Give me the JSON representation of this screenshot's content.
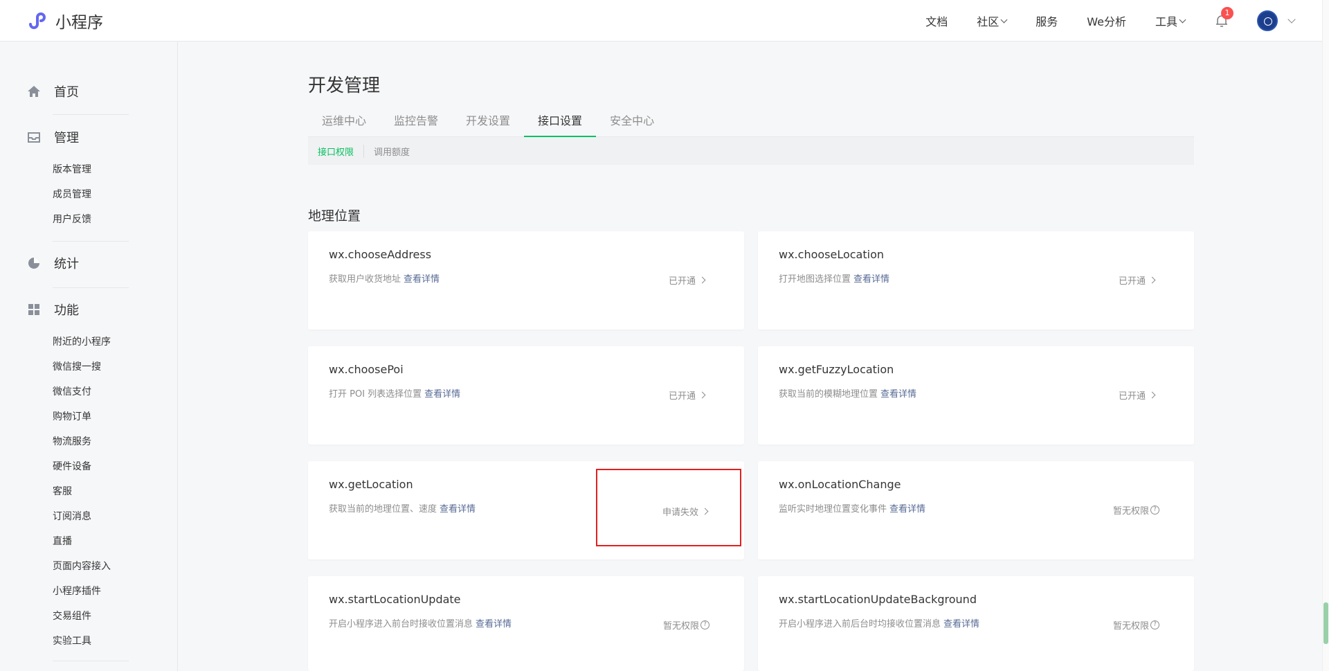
{
  "app": {
    "title": "小程序"
  },
  "nav": {
    "docs": "文档",
    "community": "社区",
    "service": "服务",
    "we_analysis": "We分析",
    "tools": "工具",
    "notification_count": "1"
  },
  "sidebar": {
    "home": "首页",
    "manage": "管理",
    "manage_items": [
      "版本管理",
      "成员管理",
      "用户反馈"
    ],
    "stats": "统计",
    "features": "功能",
    "feature_items": [
      "附近的小程序",
      "微信搜一搜",
      "微信支付",
      "购物订单",
      "物流服务",
      "硬件设备",
      "客服",
      "订阅消息",
      "直播",
      "页面内容接入",
      "小程序插件",
      "交易组件",
      "实验工具"
    ]
  },
  "page": {
    "title": "开发管理",
    "tabs": [
      "运维中心",
      "监控告警",
      "开发设置",
      "接口设置",
      "安全中心"
    ],
    "subtabs": [
      "接口权限",
      "调用额度"
    ],
    "section": "地理位置"
  },
  "cards": [
    {
      "name": "wx.chooseAddress",
      "desc": "获取用户收货地址",
      "link": "查看详情",
      "status": "已开通"
    },
    {
      "name": "wx.chooseLocation",
      "desc": "打开地图选择位置",
      "link": "查看详情",
      "status": "已开通"
    },
    {
      "name": "wx.choosePoi",
      "desc": "打开 POI 列表选择位置",
      "link": "查看详情",
      "status": "已开通"
    },
    {
      "name": "wx.getFuzzyLocation",
      "desc": "获取当前的模糊地理位置",
      "link": "查看详情",
      "status": "已开通"
    },
    {
      "name": "wx.getLocation",
      "desc": "获取当前的地理位置、速度",
      "link": "查看详情",
      "status": "申请失效"
    },
    {
      "name": "wx.onLocationChange",
      "desc": "监听实时地理位置变化事件",
      "link": "查看详情",
      "status": "暂无权限"
    },
    {
      "name": "wx.startLocationUpdate",
      "desc": "开启小程序进入前台时接收位置消息",
      "link": "查看详情",
      "status": "暂无权限"
    },
    {
      "name": "wx.startLocationUpdateBackground",
      "desc": "开启小程序进入前后台时均接收位置消息",
      "link": "查看详情",
      "status": "暂无权限"
    }
  ],
  "colors": {
    "accent": "#07c160",
    "link": "#576b95",
    "highlight": "#e02020",
    "badge": "#fa5151"
  }
}
